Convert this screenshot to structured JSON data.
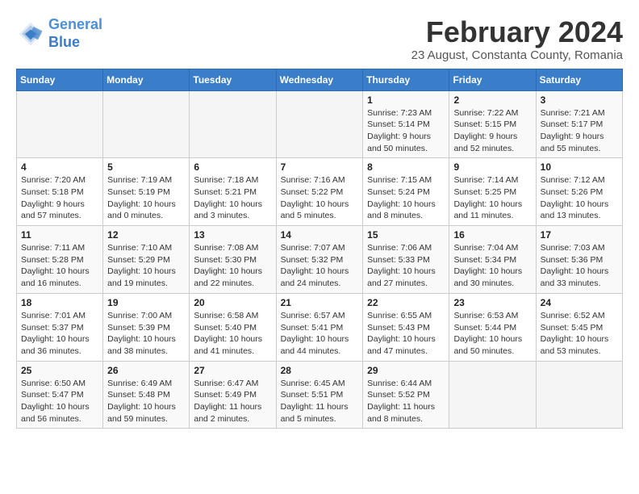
{
  "header": {
    "logo_line1": "General",
    "logo_line2": "Blue",
    "title": "February 2024",
    "subtitle": "23 August, Constanta County, Romania"
  },
  "calendar": {
    "days_of_week": [
      "Sunday",
      "Monday",
      "Tuesday",
      "Wednesday",
      "Thursday",
      "Friday",
      "Saturday"
    ],
    "weeks": [
      [
        {
          "day": "",
          "detail": ""
        },
        {
          "day": "",
          "detail": ""
        },
        {
          "day": "",
          "detail": ""
        },
        {
          "day": "",
          "detail": ""
        },
        {
          "day": "1",
          "detail": "Sunrise: 7:23 AM\nSunset: 5:14 PM\nDaylight: 9 hours\nand 50 minutes."
        },
        {
          "day": "2",
          "detail": "Sunrise: 7:22 AM\nSunset: 5:15 PM\nDaylight: 9 hours\nand 52 minutes."
        },
        {
          "day": "3",
          "detail": "Sunrise: 7:21 AM\nSunset: 5:17 PM\nDaylight: 9 hours\nand 55 minutes."
        }
      ],
      [
        {
          "day": "4",
          "detail": "Sunrise: 7:20 AM\nSunset: 5:18 PM\nDaylight: 9 hours\nand 57 minutes."
        },
        {
          "day": "5",
          "detail": "Sunrise: 7:19 AM\nSunset: 5:19 PM\nDaylight: 10 hours\nand 0 minutes."
        },
        {
          "day": "6",
          "detail": "Sunrise: 7:18 AM\nSunset: 5:21 PM\nDaylight: 10 hours\nand 3 minutes."
        },
        {
          "day": "7",
          "detail": "Sunrise: 7:16 AM\nSunset: 5:22 PM\nDaylight: 10 hours\nand 5 minutes."
        },
        {
          "day": "8",
          "detail": "Sunrise: 7:15 AM\nSunset: 5:24 PM\nDaylight: 10 hours\nand 8 minutes."
        },
        {
          "day": "9",
          "detail": "Sunrise: 7:14 AM\nSunset: 5:25 PM\nDaylight: 10 hours\nand 11 minutes."
        },
        {
          "day": "10",
          "detail": "Sunrise: 7:12 AM\nSunset: 5:26 PM\nDaylight: 10 hours\nand 13 minutes."
        }
      ],
      [
        {
          "day": "11",
          "detail": "Sunrise: 7:11 AM\nSunset: 5:28 PM\nDaylight: 10 hours\nand 16 minutes."
        },
        {
          "day": "12",
          "detail": "Sunrise: 7:10 AM\nSunset: 5:29 PM\nDaylight: 10 hours\nand 19 minutes."
        },
        {
          "day": "13",
          "detail": "Sunrise: 7:08 AM\nSunset: 5:30 PM\nDaylight: 10 hours\nand 22 minutes."
        },
        {
          "day": "14",
          "detail": "Sunrise: 7:07 AM\nSunset: 5:32 PM\nDaylight: 10 hours\nand 24 minutes."
        },
        {
          "day": "15",
          "detail": "Sunrise: 7:06 AM\nSunset: 5:33 PM\nDaylight: 10 hours\nand 27 minutes."
        },
        {
          "day": "16",
          "detail": "Sunrise: 7:04 AM\nSunset: 5:34 PM\nDaylight: 10 hours\nand 30 minutes."
        },
        {
          "day": "17",
          "detail": "Sunrise: 7:03 AM\nSunset: 5:36 PM\nDaylight: 10 hours\nand 33 minutes."
        }
      ],
      [
        {
          "day": "18",
          "detail": "Sunrise: 7:01 AM\nSunset: 5:37 PM\nDaylight: 10 hours\nand 36 minutes."
        },
        {
          "day": "19",
          "detail": "Sunrise: 7:00 AM\nSunset: 5:39 PM\nDaylight: 10 hours\nand 38 minutes."
        },
        {
          "day": "20",
          "detail": "Sunrise: 6:58 AM\nSunset: 5:40 PM\nDaylight: 10 hours\nand 41 minutes."
        },
        {
          "day": "21",
          "detail": "Sunrise: 6:57 AM\nSunset: 5:41 PM\nDaylight: 10 hours\nand 44 minutes."
        },
        {
          "day": "22",
          "detail": "Sunrise: 6:55 AM\nSunset: 5:43 PM\nDaylight: 10 hours\nand 47 minutes."
        },
        {
          "day": "23",
          "detail": "Sunrise: 6:53 AM\nSunset: 5:44 PM\nDaylight: 10 hours\nand 50 minutes."
        },
        {
          "day": "24",
          "detail": "Sunrise: 6:52 AM\nSunset: 5:45 PM\nDaylight: 10 hours\nand 53 minutes."
        }
      ],
      [
        {
          "day": "25",
          "detail": "Sunrise: 6:50 AM\nSunset: 5:47 PM\nDaylight: 10 hours\nand 56 minutes."
        },
        {
          "day": "26",
          "detail": "Sunrise: 6:49 AM\nSunset: 5:48 PM\nDaylight: 10 hours\nand 59 minutes."
        },
        {
          "day": "27",
          "detail": "Sunrise: 6:47 AM\nSunset: 5:49 PM\nDaylight: 11 hours\nand 2 minutes."
        },
        {
          "day": "28",
          "detail": "Sunrise: 6:45 AM\nSunset: 5:51 PM\nDaylight: 11 hours\nand 5 minutes."
        },
        {
          "day": "29",
          "detail": "Sunrise: 6:44 AM\nSunset: 5:52 PM\nDaylight: 11 hours\nand 8 minutes."
        },
        {
          "day": "",
          "detail": ""
        },
        {
          "day": "",
          "detail": ""
        }
      ]
    ]
  }
}
